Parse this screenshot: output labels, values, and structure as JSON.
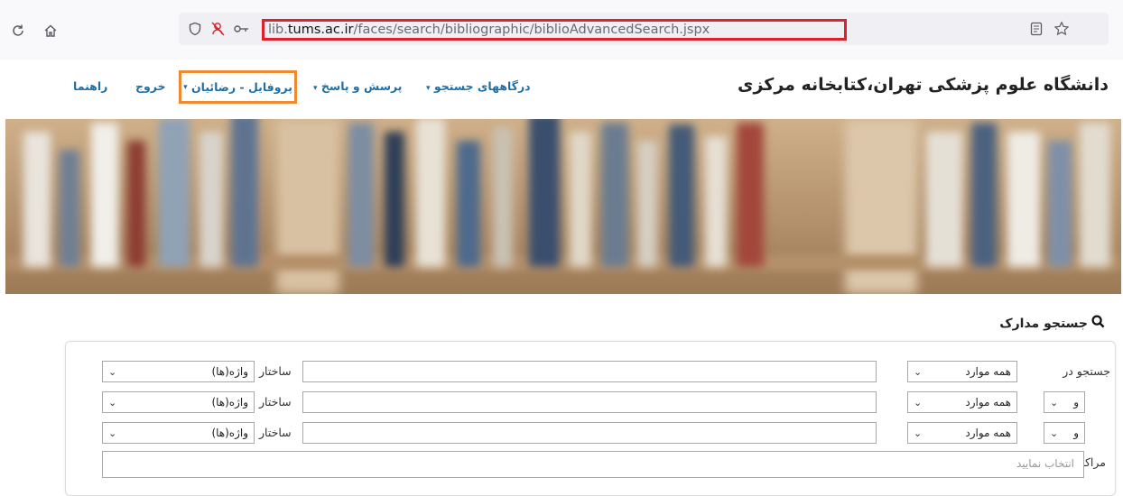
{
  "browser": {
    "url_prefix": "lib.",
    "url_host": "tums.ac.ir",
    "url_path": "/faces/search/bibliographic/biblioAdvancedSearch.jspx",
    "icons": [
      "reload-icon",
      "home-icon",
      "shield-icon",
      "tracking-icon",
      "permissions-icon",
      "reader-view-icon",
      "bookmark-star-icon"
    ]
  },
  "header": {
    "title": "دانشگاه علوم پزشکی تهران،کتابخانه مرکزی",
    "nav": {
      "portals": "درگاههای جستجو",
      "qa": "پرسش و پاسخ",
      "profile": "پروفایل - رضائیان",
      "logout": "خروج",
      "help": "راهنما"
    },
    "caret": "▾",
    "link_color": "#1e6fa8",
    "highlight_colors": {
      "url": "#e0202a",
      "profile": "#ef8a31"
    }
  },
  "search": {
    "heading": "جستجو مدارک",
    "search_in_label": "جستجو در",
    "structure_label": "ساختار",
    "rows": [
      {
        "field": "همه موارد",
        "structure": "واژه(ها)"
      },
      {
        "operator": "و",
        "field": "همه موارد",
        "structure": "واژه(ها)"
      },
      {
        "operator": "و",
        "field": "همه موارد",
        "structure": "واژه(ها)"
      }
    ],
    "centers_label": "مراکز",
    "centers_placeholder": "انتخاب نمایید",
    "chevron": "⌄"
  }
}
